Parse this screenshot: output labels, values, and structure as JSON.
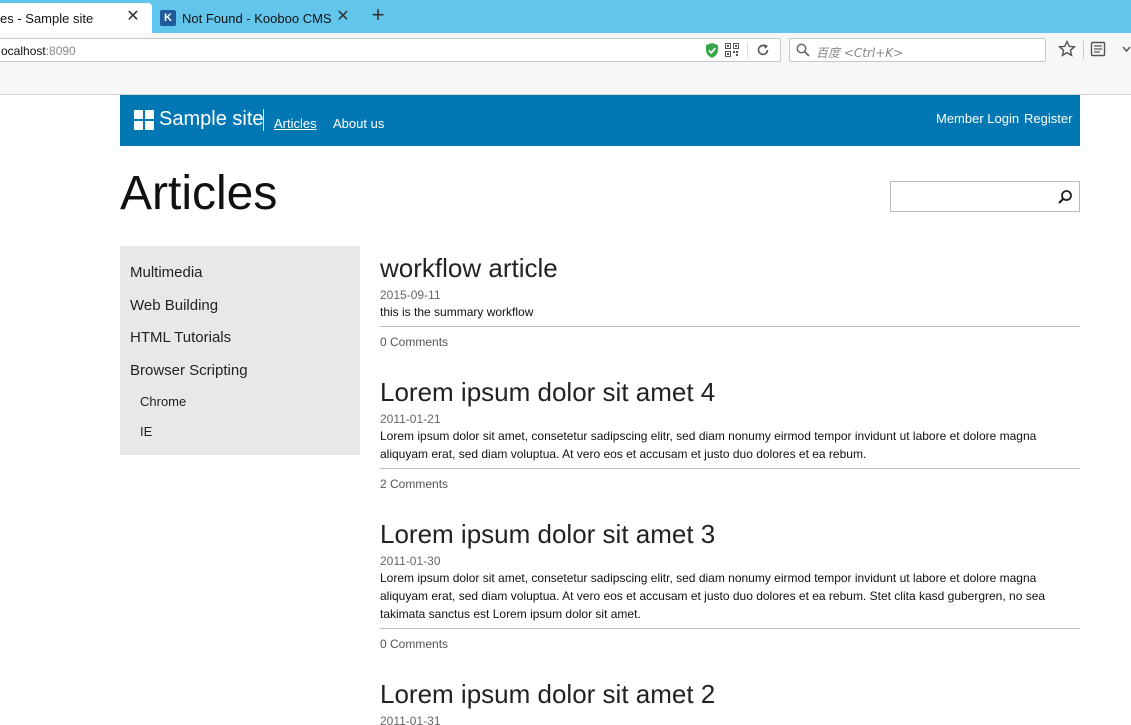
{
  "browser": {
    "tabs": [
      {
        "title": "es - Sample site",
        "active": true
      },
      {
        "title": "Not Found - Kooboo CMS",
        "active": false,
        "favicon": "k-icon"
      }
    ],
    "new_tab_label": "+",
    "url_host": "ocalhost",
    "url_port": ":8090",
    "search_placeholder": "百度 <Ctrl+K>",
    "colors": {
      "tabstrip": "#62c5ec",
      "toolbar": "#f7f7f7"
    }
  },
  "site": {
    "name": "Sample site",
    "nav": [
      {
        "label": "Articles",
        "current": true
      },
      {
        "label": "About us",
        "current": false
      }
    ],
    "member_login": "Member Login",
    "register": "Register",
    "colors": {
      "header": "#0178b4"
    }
  },
  "page": {
    "title": "Articles",
    "search_value": ""
  },
  "sidebar": {
    "categories": [
      "Multimedia",
      "Web Building",
      "HTML Tutorials",
      "Browser Scripting"
    ],
    "subcategories": [
      "Chrome",
      "IE"
    ]
  },
  "articles": [
    {
      "title": "workflow article",
      "date": "2015-09-11",
      "summary": "this is the summary workflow",
      "comments": "0 Comments"
    },
    {
      "title": "Lorem ipsum dolor sit amet 4",
      "date": "2011-01-21",
      "summary": "Lorem ipsum dolor sit amet, consetetur sadipscing elitr, sed diam nonumy eirmod tempor invidunt ut labore et dolore magna aliquyam erat, sed diam voluptua. At vero eos et accusam et justo duo dolores et ea rebum.",
      "comments": "2 Comments"
    },
    {
      "title": "Lorem ipsum dolor sit amet 3",
      "date": "2011-01-30",
      "summary": "Lorem ipsum dolor sit amet, consetetur sadipscing elitr, sed diam nonumy eirmod tempor invidunt ut labore et dolore magna aliquyam erat, sed diam voluptua. At vero eos et accusam et justo duo dolores et ea rebum. Stet clita kasd gubergren, no sea takimata sanctus est Lorem ipsum dolor sit amet.",
      "comments": "0 Comments"
    },
    {
      "title": "Lorem ipsum dolor sit amet 2",
      "date": "2011-01-31"
    }
  ]
}
